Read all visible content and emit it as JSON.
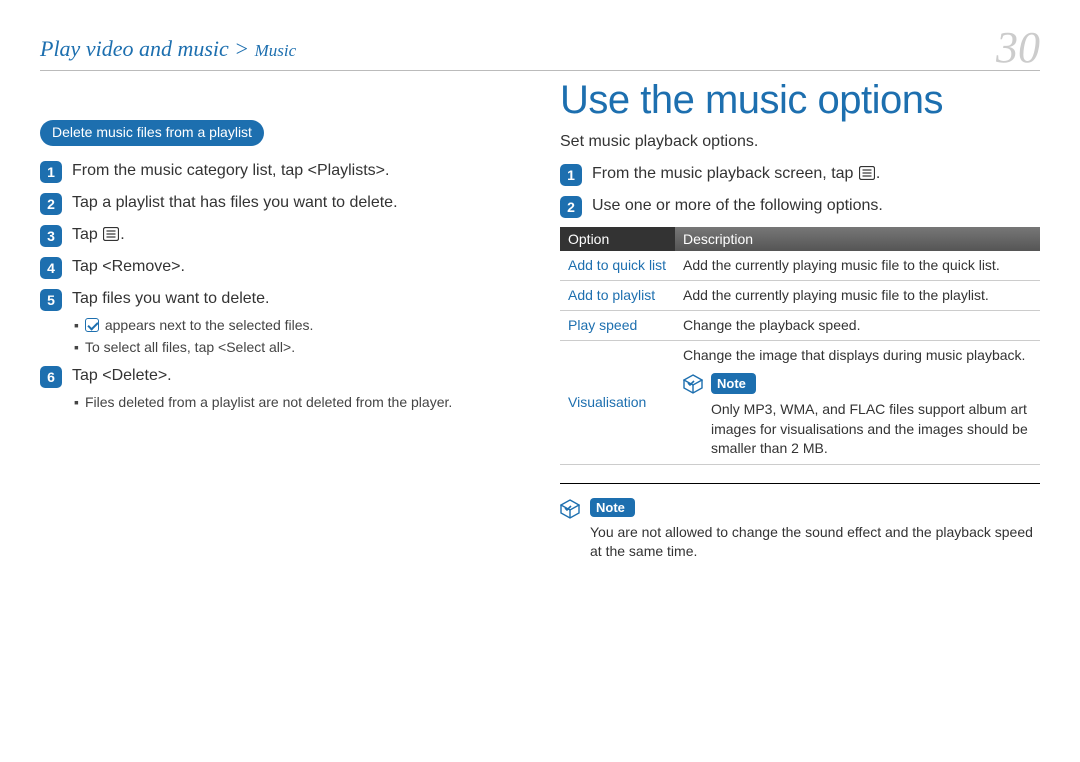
{
  "header": {
    "breadcrumb_main": "Play video and music >",
    "breadcrumb_sub": "Music",
    "page_number": "30"
  },
  "left": {
    "pill": "Delete music files from a playlist",
    "steps": [
      "From the music category list, tap <Playlists>.",
      "Tap a playlist that has files you want to delete.",
      "Tap ",
      "Tap <Remove>.",
      "Tap files you want to delete.",
      "Tap <Delete>."
    ],
    "step3_suffix": ".",
    "sub5": {
      "a_suffix": " appears next to the selected files.",
      "b": "To select all files, tap <Select all>."
    },
    "sub6": "Files deleted from a playlist are not deleted from the player."
  },
  "right": {
    "title": "Use the music options",
    "intro": "Set music playback options.",
    "steps": [
      "From the music playback screen, tap ",
      "Use one or more of the following options."
    ],
    "step1_suffix": ".",
    "table": {
      "headers": [
        "Option",
        "Description"
      ],
      "rows": [
        {
          "opt": "Add to quick list",
          "desc": "Add the currently playing music file to the quick list."
        },
        {
          "opt": "Add to playlist",
          "desc": "Add the currently playing music file to the playlist."
        },
        {
          "opt": "Play speed",
          "desc": "Change the playback speed."
        }
      ],
      "vis": {
        "opt": "Visualisation",
        "desc": "Change the image that displays during music playback.",
        "note_label": "Note",
        "note_body": "Only MP3, WMA, and FLAC files support album art images for visualisations and the images should be smaller than 2 MB."
      }
    },
    "bottom_note": {
      "label": "Note",
      "body": "You are not allowed to change the sound effect and the playback speed at the same time."
    }
  }
}
